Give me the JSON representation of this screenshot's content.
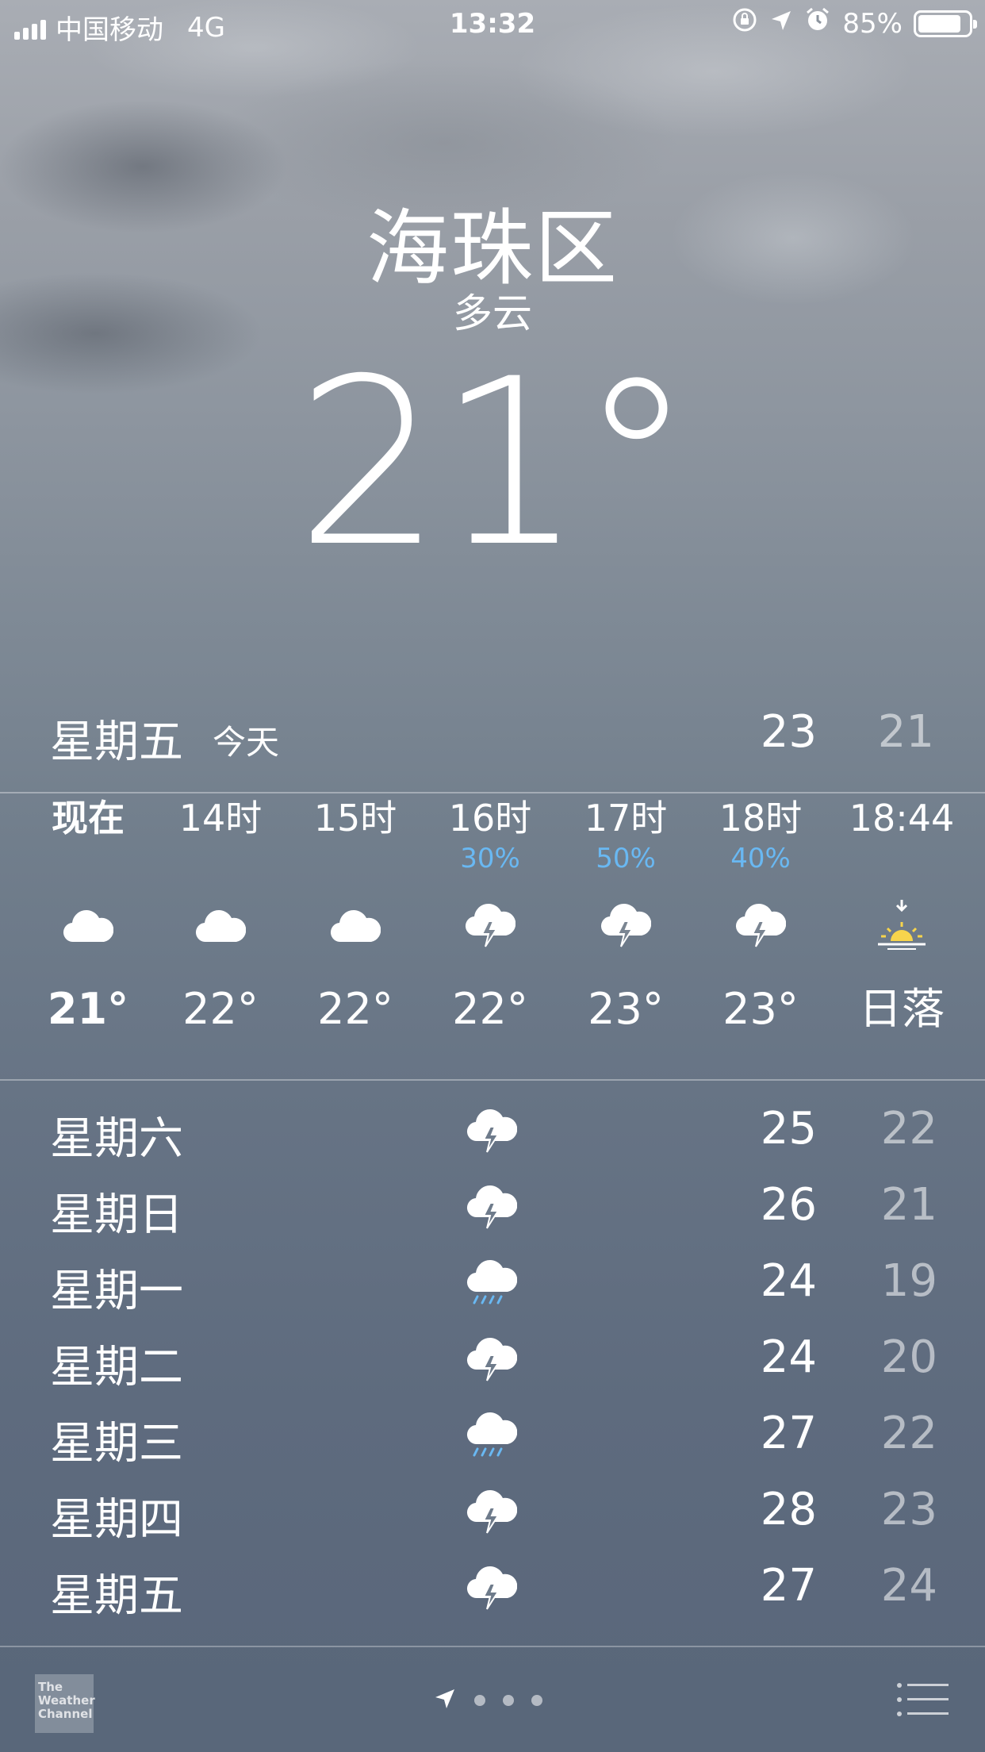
{
  "status_bar": {
    "carrier": "中国移动",
    "network": "4G",
    "time": "13:32",
    "battery": "85%",
    "battery_level": 0.85
  },
  "location": {
    "city": "海珠区",
    "condition": "多云",
    "temperature": "21°"
  },
  "today": {
    "day": "星期五",
    "label": "今天",
    "high": "23",
    "low": "21"
  },
  "hourly": [
    {
      "label": "现在",
      "pop": "",
      "icon": "cloud-icon",
      "temp": "21°"
    },
    {
      "label": "14时",
      "pop": "",
      "icon": "cloud-icon",
      "temp": "22°"
    },
    {
      "label": "15时",
      "pop": "",
      "icon": "cloud-icon",
      "temp": "22°"
    },
    {
      "label": "16时",
      "pop": "30%",
      "icon": "thunderstorm-icon",
      "temp": "22°"
    },
    {
      "label": "17时",
      "pop": "50%",
      "icon": "thunderstorm-icon",
      "temp": "23°"
    },
    {
      "label": "18时",
      "pop": "40%",
      "icon": "thunderstorm-icon",
      "temp": "23°"
    },
    {
      "label": "18:44",
      "pop": "",
      "icon": "sunset-icon",
      "temp": "日落"
    }
  ],
  "daily": [
    {
      "day": "星期六",
      "icon": "thunderstorm-icon",
      "high": "25",
      "low": "22"
    },
    {
      "day": "星期日",
      "icon": "thunderstorm-icon",
      "high": "26",
      "low": "21"
    },
    {
      "day": "星期一",
      "icon": "rain-icon",
      "high": "24",
      "low": "19"
    },
    {
      "day": "星期二",
      "icon": "thunderstorm-icon",
      "high": "24",
      "low": "20"
    },
    {
      "day": "星期三",
      "icon": "rain-icon",
      "high": "27",
      "low": "22"
    },
    {
      "day": "星期四",
      "icon": "thunderstorm-icon",
      "high": "28",
      "low": "23"
    },
    {
      "day": "星期五",
      "icon": "thunderstorm-icon",
      "high": "27",
      "low": "24"
    }
  ],
  "bottom_bar": {
    "logo_text": "The Weather Channel",
    "logo_line1": "The",
    "logo_line2": "Weather",
    "logo_line3": "Channel"
  },
  "colors": {
    "pop_blue": "#69b8f2",
    "sun_yellow": "#f7d44c",
    "rain_blue": "#69b8f2"
  }
}
